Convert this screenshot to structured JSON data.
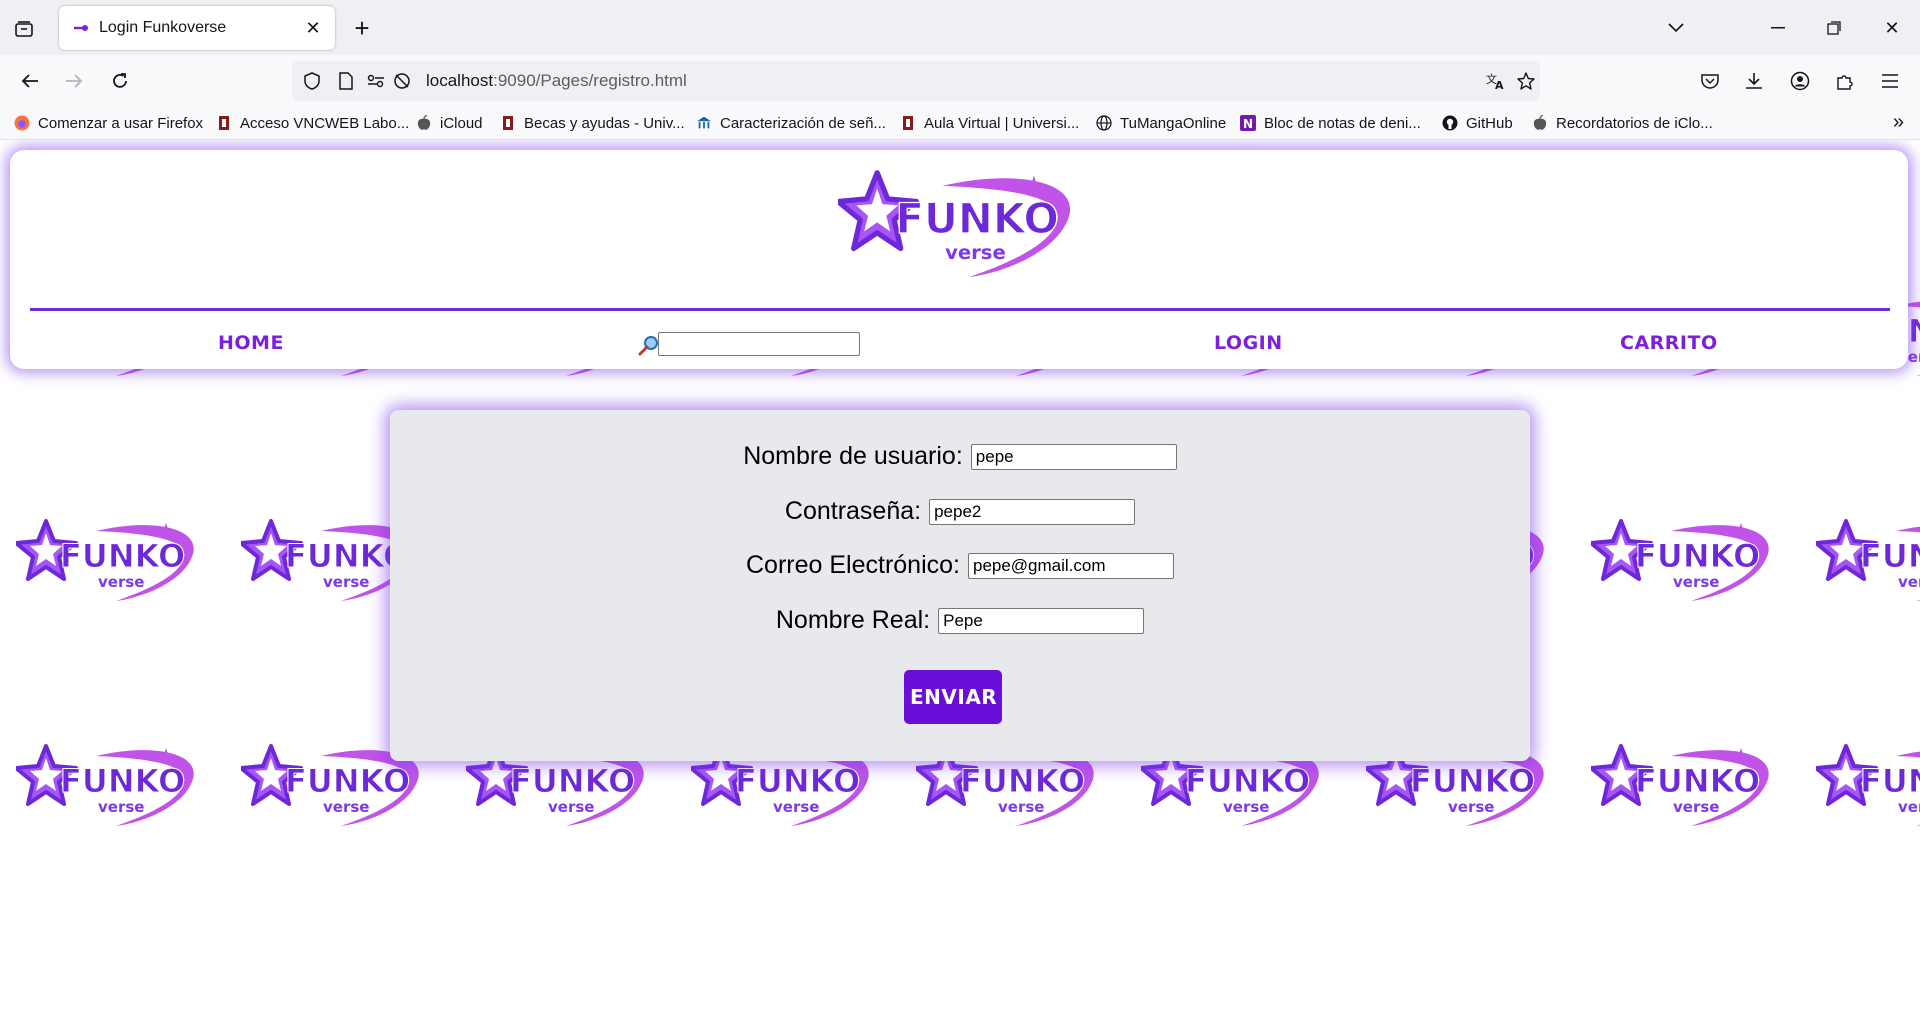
{
  "browser": {
    "tab_title": "Login Funkoverse",
    "url_host": "localhost",
    "url_path": ":9090/Pages/registro.html",
    "bookmarks": [
      {
        "label": "Comenzar a usar Firefox",
        "icon": "firefox-icon"
      },
      {
        "label": "Acceso VNCWEB Labo...",
        "icon": "university-icon"
      },
      {
        "label": "iCloud",
        "icon": "apple-icon"
      },
      {
        "label": "Becas y ayudas - Univ...",
        "icon": "university-icon"
      },
      {
        "label": "Caracterización de señ...",
        "icon": "institution-icon"
      },
      {
        "label": "Aula Virtual | Universi...",
        "icon": "university-icon"
      },
      {
        "label": "TuMangaOnline",
        "icon": "globe-icon"
      },
      {
        "label": "Bloc de notas de deni...",
        "icon": "onenote-icon"
      },
      {
        "label": "GitHub",
        "icon": "github-icon"
      },
      {
        "label": "Recordatorios de iClo...",
        "icon": "apple-icon"
      }
    ]
  },
  "site": {
    "logo_text": "FUNKO",
    "logo_sub": "verse",
    "nav": {
      "home": "Home",
      "login": "Login",
      "cart": "Carrito"
    },
    "search": {
      "icon": "magnifier-icon",
      "value": ""
    }
  },
  "form": {
    "username_label": "Nombre de usuario:",
    "username_value": "pepe",
    "password_label": "Contraseña:",
    "password_value": "pepe2",
    "email_label": "Correo Electrónico:",
    "email_value": "pepe@gmail.com",
    "realname_label": "Nombre Real:",
    "realname_value": "Pepe",
    "submit_label": "Enviar"
  },
  "colors": {
    "brand_purple": "#7c1fe0",
    "button_purple": "#6a0fd8",
    "glow": "#7c3aed",
    "card_bg": "#e8e9ed",
    "logo_light": "#c054e8"
  }
}
